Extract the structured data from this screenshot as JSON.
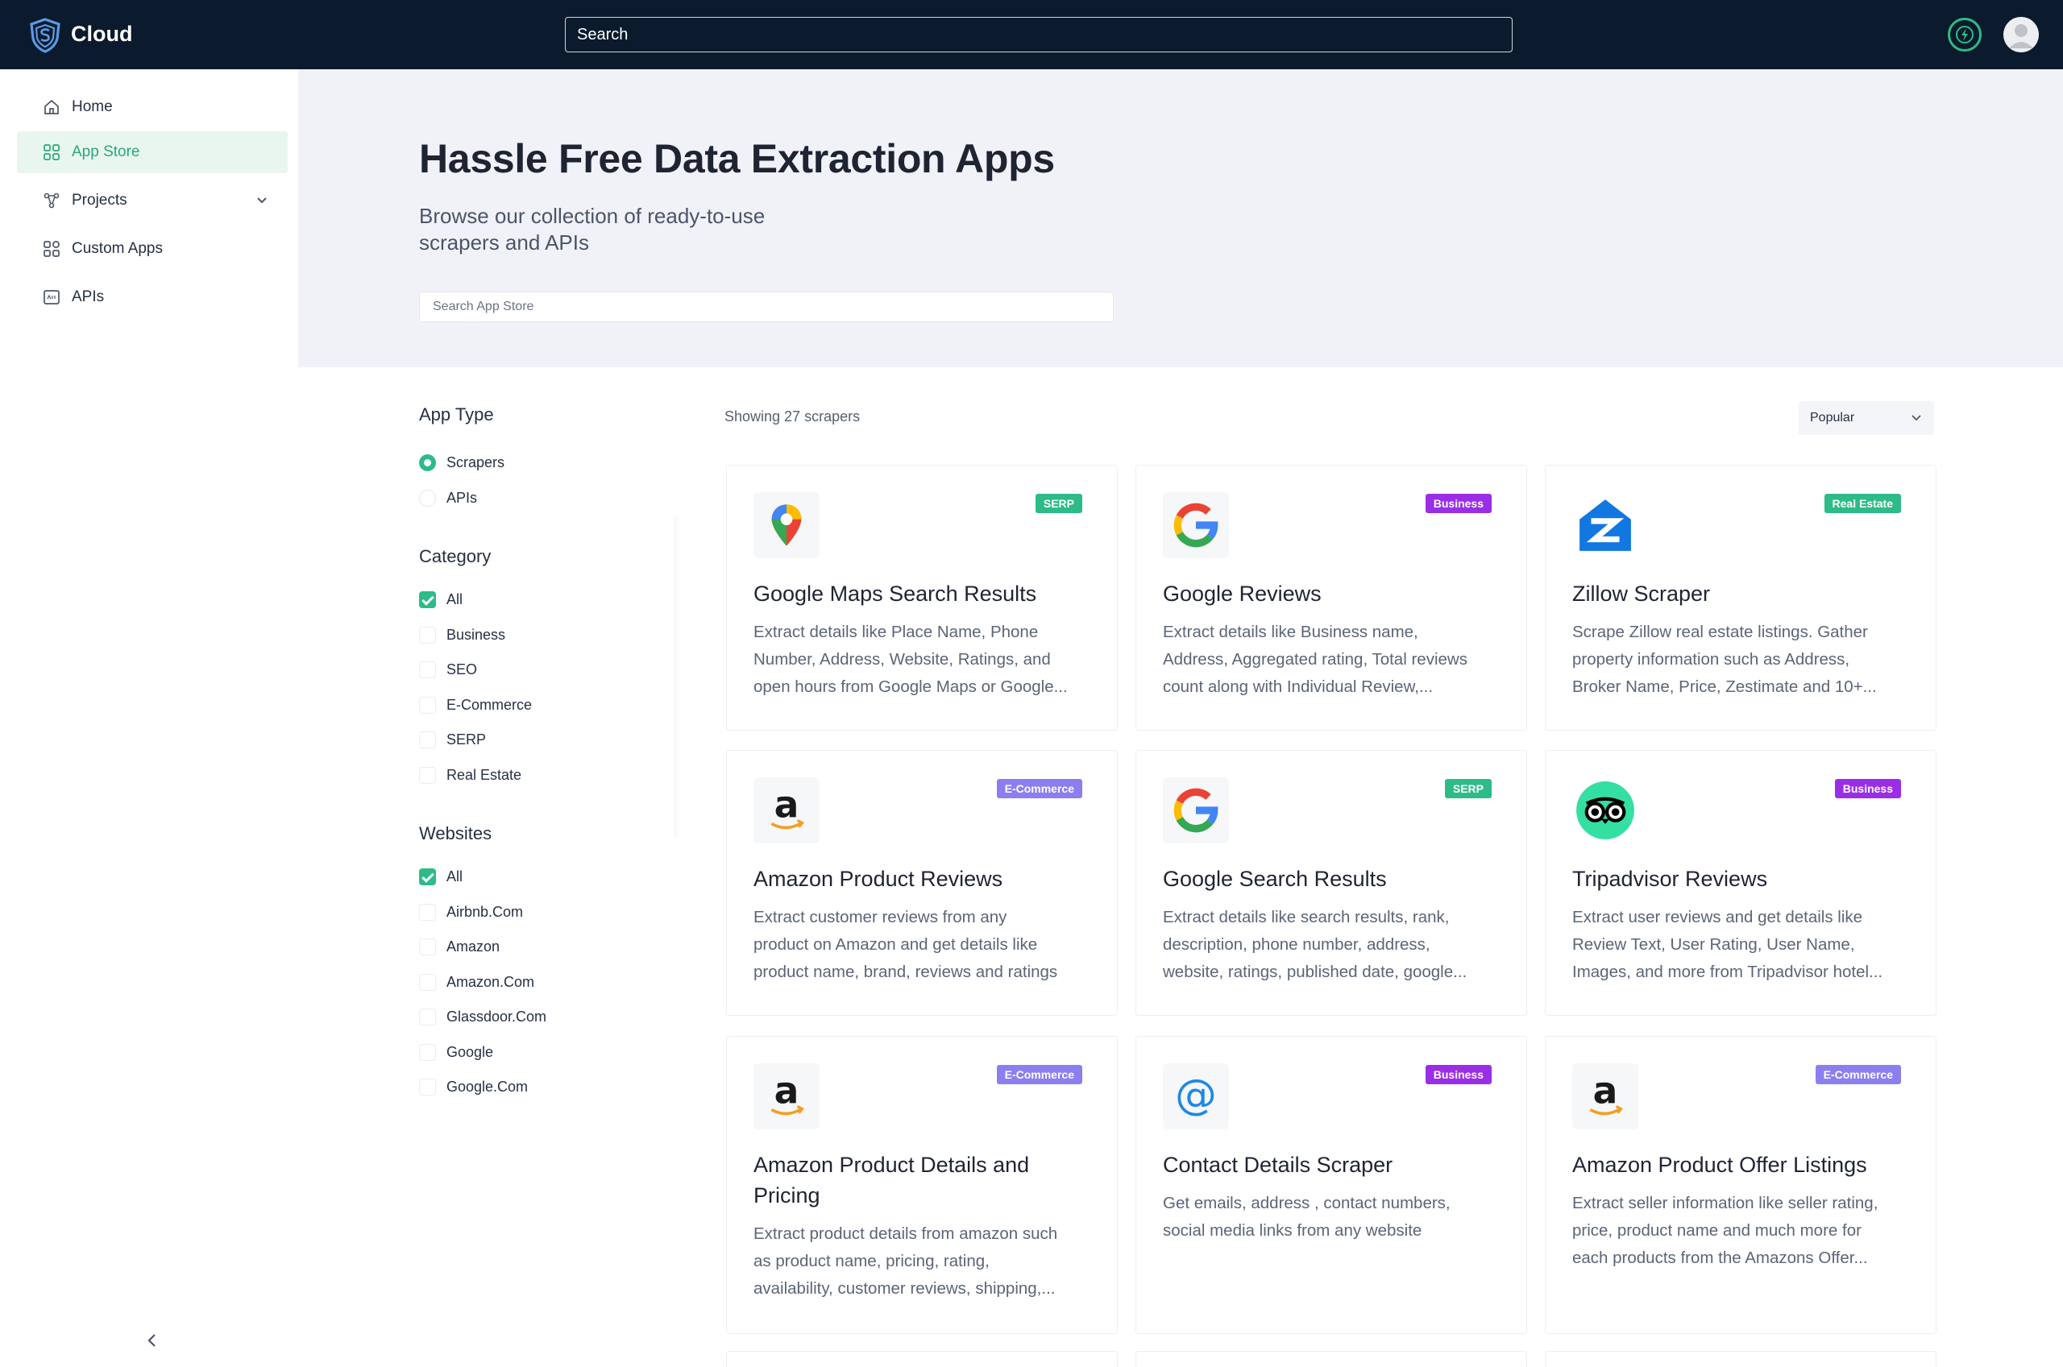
{
  "topbar": {
    "brand": "Cloud",
    "search_placeholder": "Search"
  },
  "sidebar": {
    "items": [
      {
        "label": "Home",
        "icon": "home-icon"
      },
      {
        "label": "App Store",
        "icon": "grid-icon",
        "active": true
      },
      {
        "label": "Projects",
        "icon": "nodes-icon",
        "expandable": true
      },
      {
        "label": "Custom Apps",
        "icon": "apps-icon"
      },
      {
        "label": "APIs",
        "icon": "api-icon"
      }
    ]
  },
  "hero": {
    "title": "Hassle Free Data Extraction Apps",
    "subtitle_line1": "Browse our collection of ready-to-use",
    "subtitle_line2": "scrapers and APIs",
    "search_placeholder": "Search App Store"
  },
  "filters": {
    "app_type": {
      "heading": "App Type",
      "options": [
        {
          "label": "Scrapers",
          "selected": true
        },
        {
          "label": "APIs",
          "selected": false
        }
      ]
    },
    "category": {
      "heading": "Category",
      "options": [
        {
          "label": "All",
          "checked": true
        },
        {
          "label": "Business",
          "checked": false
        },
        {
          "label": "SEO",
          "checked": false
        },
        {
          "label": "E-Commerce",
          "checked": false
        },
        {
          "label": "SERP",
          "checked": false
        },
        {
          "label": "Real Estate",
          "checked": false
        }
      ]
    },
    "websites": {
      "heading": "Websites",
      "options": [
        {
          "label": "All",
          "checked": true
        },
        {
          "label": "Airbnb.Com",
          "checked": false
        },
        {
          "label": "Amazon",
          "checked": false
        },
        {
          "label": "Amazon.Com",
          "checked": false
        },
        {
          "label": "Glassdoor.Com",
          "checked": false
        },
        {
          "label": "Google",
          "checked": false
        },
        {
          "label": "Google.Com",
          "checked": false
        }
      ]
    }
  },
  "results": {
    "showing": "Showing 27 scrapers",
    "sort_value": "Popular"
  },
  "cards": [
    {
      "title": "Google Maps Search Results",
      "badge": "SERP",
      "icon": "google-maps-pin-icon",
      "desc": [
        "Extract details like Place Name, Phone",
        "Number, Address, Website, Ratings, and",
        "open hours from Google Maps or Google..."
      ]
    },
    {
      "title": "Google Reviews",
      "badge": "Business",
      "icon": "google-g-icon",
      "desc": [
        "Extract details like Business name,",
        "Address, Aggregated rating, Total reviews",
        "count along with Individual Review,..."
      ]
    },
    {
      "title": "Zillow Scraper",
      "badge": "Real Estate",
      "icon": "zillow-icon",
      "desc": [
        "Scrape Zillow real estate listings. Gather",
        "property information such as Address,",
        "Broker Name, Price, Zestimate and 10+..."
      ]
    },
    {
      "title": "Amazon Product Reviews",
      "badge": "E-Commerce",
      "icon": "amazon-icon",
      "desc": [
        "Extract customer reviews from any",
        "product on Amazon and get details like",
        "product name, brand, reviews and ratings"
      ]
    },
    {
      "title": "Google Search Results",
      "badge": "SERP",
      "icon": "google-g-icon",
      "desc": [
        "Extract details like search results, rank,",
        "description, phone number, address,",
        "website, ratings, published date, google..."
      ]
    },
    {
      "title": "Tripadvisor Reviews",
      "badge": "Business",
      "icon": "tripadvisor-owl-icon",
      "desc": [
        "Extract user reviews and get details like",
        "Review Text, User Rating, User Name,",
        "Images, and more from Tripadvisor hotel..."
      ]
    },
    {
      "title_line1": "Amazon Product Details and",
      "title_line2": "Pricing",
      "badge": "E-Commerce",
      "icon": "amazon-icon",
      "desc": [
        "Extract product details from amazon such",
        "as product name, pricing, rating,",
        "availability, customer reviews, shipping,..."
      ]
    },
    {
      "title": "Contact Details Scraper",
      "badge": "Business",
      "icon": "at-sign-icon",
      "desc": [
        "Get emails, address , contact numbers,",
        "social media links from any website"
      ]
    },
    {
      "title": "Amazon Product Offer Listings",
      "badge": "E-Commerce",
      "icon": "amazon-icon",
      "desc": [
        "Extract seller information like seller rating,",
        "price, product name and much more for",
        "each products from the Amazons Offer..."
      ]
    }
  ],
  "colors": {
    "topbar": "#0b1a2c",
    "accent": "#2dbb87",
    "badge_serp": "#2dbb87",
    "badge_business": "#9a2ee6",
    "badge_real_estate": "#2dbb87",
    "badge_ecommerce": "#8b7ff0"
  }
}
